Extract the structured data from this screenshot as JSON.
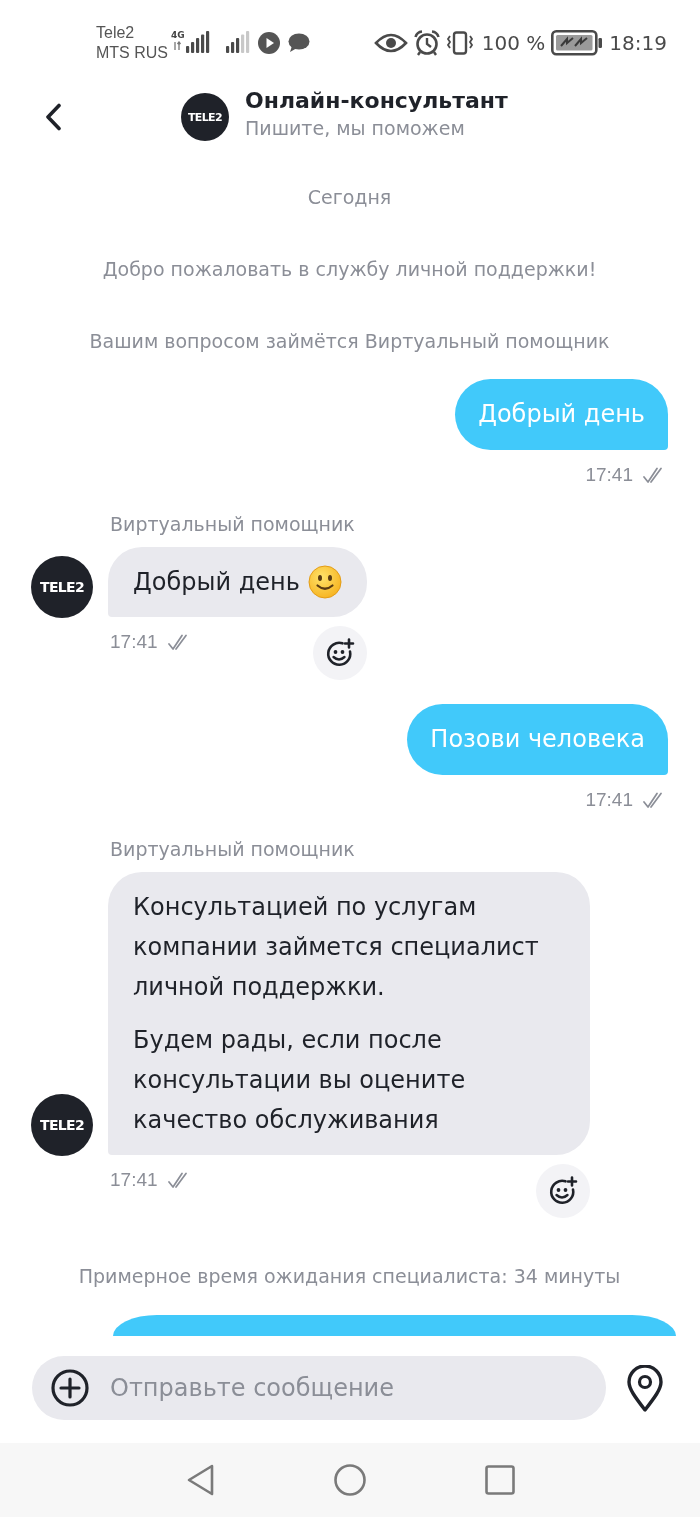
{
  "status_bar": {
    "carriers": [
      "Tele2",
      "MTS RUS"
    ],
    "network": "4G",
    "battery": "100 %",
    "time": "18:19"
  },
  "header": {
    "logo": "TELE2",
    "title": "Онлайн-консультант",
    "subtitle": "Пишите, мы поможем"
  },
  "messages": [
    {
      "kind": "date",
      "text": "Сегодня"
    },
    {
      "kind": "system",
      "text": "Добро пожаловать в службу личной поддержки!"
    },
    {
      "kind": "system",
      "text": "Вашим вопросом займётся Виртуальный помощник"
    },
    {
      "kind": "outgoing",
      "paragraphs": [
        "Добрый день"
      ],
      "time": "17:41",
      "read": true
    },
    {
      "kind": "incoming",
      "sender": "Виртуальный помощник",
      "avatar": "TELE2",
      "paragraphs": [
        "Добрый день"
      ],
      "emoji": true,
      "time": "17:41",
      "read": true,
      "reaction": true
    },
    {
      "kind": "outgoing",
      "paragraphs": [
        "Позови человека"
      ],
      "time": "17:41",
      "read": true
    },
    {
      "kind": "incoming",
      "sender": "Виртуальный помощник",
      "avatar": "TELE2",
      "paragraphs": [
        "Консультацией по услугам компании займется специалист личной поддержки.",
        "Будем рады, если после консультации вы оцените качество обслуживания"
      ],
      "time": "17:41",
      "read": true,
      "reaction": true
    },
    {
      "kind": "system",
      "text": "Примерное время ожидания специалиста: 34 минуты"
    },
    {
      "kind": "outgoing_cut"
    }
  ],
  "composer": {
    "placeholder": "Отправьте сообщение"
  }
}
